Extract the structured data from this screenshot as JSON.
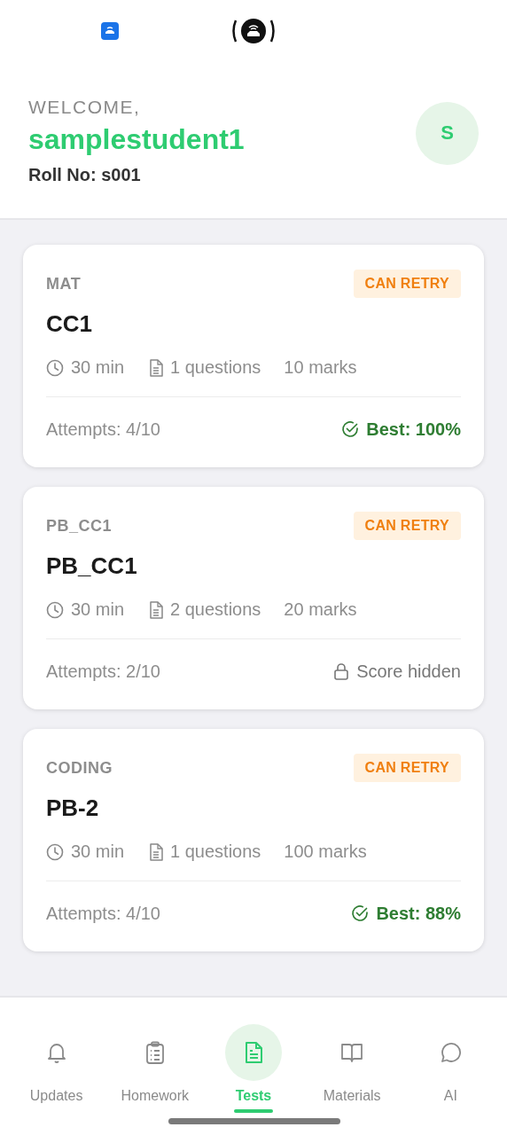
{
  "header": {
    "greeting": "WELCOME,",
    "name": "samplestudent1",
    "roll": "Roll No: s001",
    "avatar": "S"
  },
  "tests": [
    {
      "subject": "MAT",
      "status": "CAN RETRY",
      "title": "CC1",
      "duration": "30 min",
      "questions": "1 questions",
      "marks": "10 marks",
      "attempts": "Attempts: 4/10",
      "result": {
        "kind": "best",
        "text": "Best: 100%"
      }
    },
    {
      "subject": "PB_CC1",
      "status": "CAN RETRY",
      "title": "PB_CC1",
      "duration": "30 min",
      "questions": "2 questions",
      "marks": "20 marks",
      "attempts": "Attempts: 2/10",
      "result": {
        "kind": "hidden",
        "text": "Score hidden"
      }
    },
    {
      "subject": "CODING",
      "status": "CAN RETRY",
      "title": "PB-2",
      "duration": "30 min",
      "questions": "1 questions",
      "marks": "100 marks",
      "attempts": "Attempts: 4/10",
      "result": {
        "kind": "best",
        "text": "Best: 88%"
      }
    }
  ],
  "nav": [
    {
      "label": "Updates",
      "selected": false
    },
    {
      "label": "Homework",
      "selected": false
    },
    {
      "label": "Tests",
      "selected": true
    },
    {
      "label": "Materials",
      "selected": false
    },
    {
      "label": "AI",
      "selected": false
    }
  ]
}
